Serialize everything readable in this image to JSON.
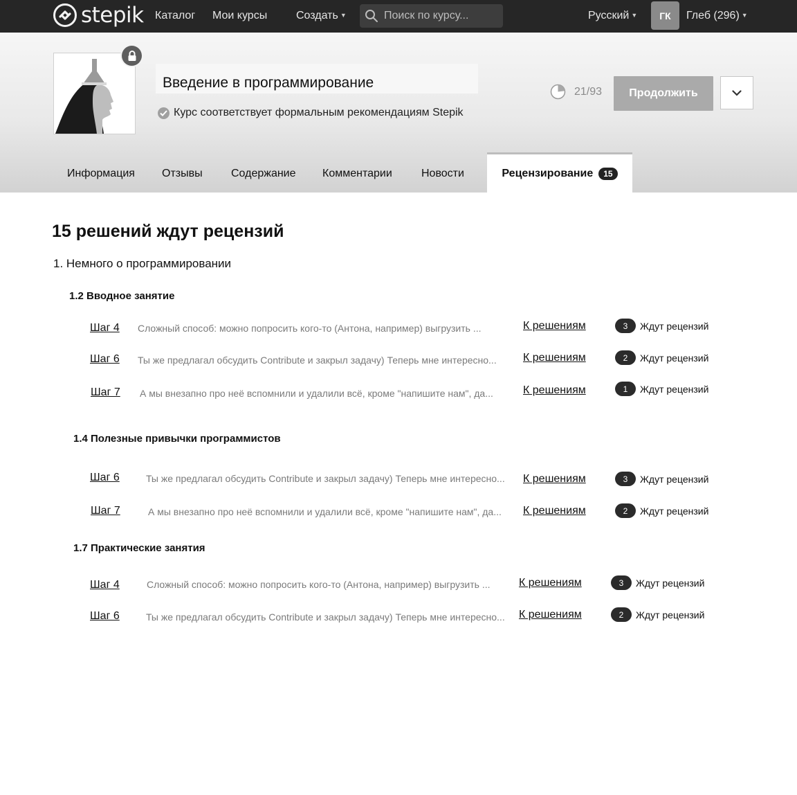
{
  "nav": {
    "logo_text": "stepik",
    "catalog": "Каталог",
    "my_courses": "Мои курсы",
    "create": "Создать",
    "search_placeholder": "Поиск по курсу...",
    "language": "Русский",
    "avatar_initials": "ГК",
    "user": "Глеб (296)"
  },
  "course": {
    "title": "Введение в программирование",
    "certified": "Курс соответствует формальным рекомендациям Stepik",
    "progress": "21/93",
    "progress_fraction": 0.23,
    "continue_label": "Продолжить"
  },
  "tabs": [
    {
      "label": "Информация"
    },
    {
      "label": "Отзывы"
    },
    {
      "label": "Содержание"
    },
    {
      "label": "Комментарии"
    },
    {
      "label": "Новости"
    },
    {
      "label": "Рецензирование",
      "count": "15",
      "active": true
    }
  ],
  "content": {
    "heading": "15 решений ждут рецензий",
    "module": "1. Немного о программировании",
    "lessons": [
      {
        "title": "1.2 Вводное занятие",
        "steps": [
          {
            "step": "Шаг 4",
            "snippet": "Сложный способ: можно попросить кого-то (Антона, например) выгрузить ...",
            "link": "К решениям",
            "count": "3",
            "status": "Ждут рецензий"
          },
          {
            "step": "Шаг 6",
            "snippet": "Ты же предлагал обсудить Contribute и закрыл задачу) Теперь мне интересно...",
            "link": "К решениям",
            "count": "2",
            "status": "Ждут рецензий"
          },
          {
            "step": "Шаг 7",
            "snippet": "А мы внезапно про неё вспомнили и удалили всё, кроме \"напишите нам\", да...",
            "link": "К решениям",
            "count": "1",
            "status": "Ждут рецензий"
          }
        ]
      },
      {
        "title": "1.4 Полезные привычки программистов",
        "steps": [
          {
            "step": "Шаг 6",
            "snippet": "Ты же предлагал обсудить Contribute и закрыл задачу) Теперь мне интересно...",
            "link": "К решениям",
            "count": "3",
            "status": "Ждут рецензий"
          },
          {
            "step": "Шаг 7",
            "snippet": "А мы внезапно про неё вспомнили и удалили всё, кроме \"напишите нам\", да...",
            "link": "К решениям",
            "count": "2",
            "status": "Ждут рецензий"
          }
        ]
      },
      {
        "title": "1.7 Практические занятия",
        "steps": [
          {
            "step": "Шаг 4",
            "snippet": "Сложный способ: можно попросить кого-то (Антона, например) выгрузить ...",
            "link": "К решениям",
            "count": "3",
            "status": "Ждут рецензий"
          },
          {
            "step": "Шаг 6",
            "snippet": "Ты же предлагал обсудить Contribute и закрыл задачу) Теперь мне интересно...",
            "link": "К решениям",
            "count": "2",
            "status": "Ждут рецензий"
          }
        ]
      }
    ]
  }
}
